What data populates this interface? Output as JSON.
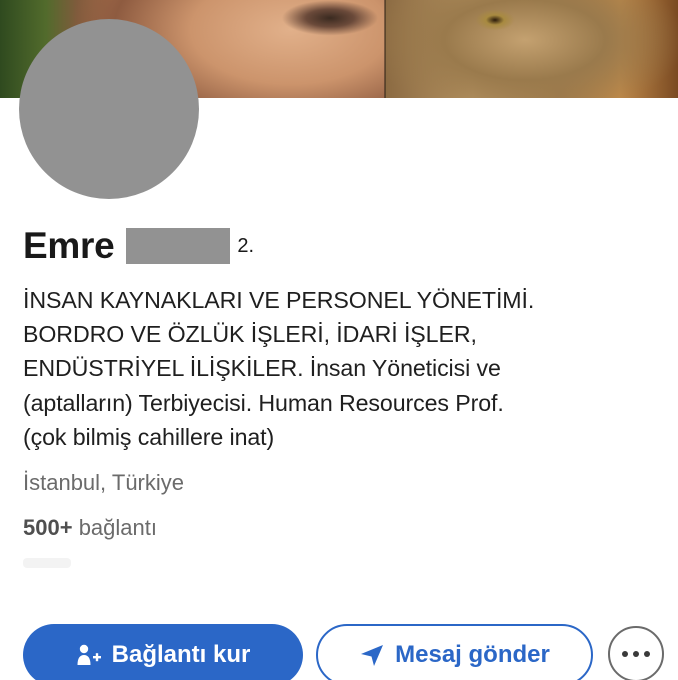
{
  "profile": {
    "first_name": "Emre",
    "connection_degree": "2.",
    "headline_lines": [
      "İNSAN KAYNAKLARI VE PERSONEL YÖNETİMİ.",
      "BORDRO VE ÖZLÜK İŞLERİ, İDARİ İŞLER,",
      "ENDÜSTRİYEL İLİŞKİLER. İnsan Yöneticisi ve",
      "(aptalların) Terbiyecisi. Human Resources Prof.",
      "(çok bilmiş cahillere inat)"
    ],
    "location": "İstanbul, Türkiye",
    "connections_count": "500+",
    "connections_label": "bağlantı"
  },
  "actions": {
    "connect_label": "Bağlantı kur",
    "message_label": "Mesaj gönder"
  },
  "icons": {
    "connect": "add-person-icon",
    "message": "send-icon",
    "more": "more-horizontal-icon"
  },
  "colors": {
    "accent": "#2b67c7",
    "redaction": "#929292"
  }
}
